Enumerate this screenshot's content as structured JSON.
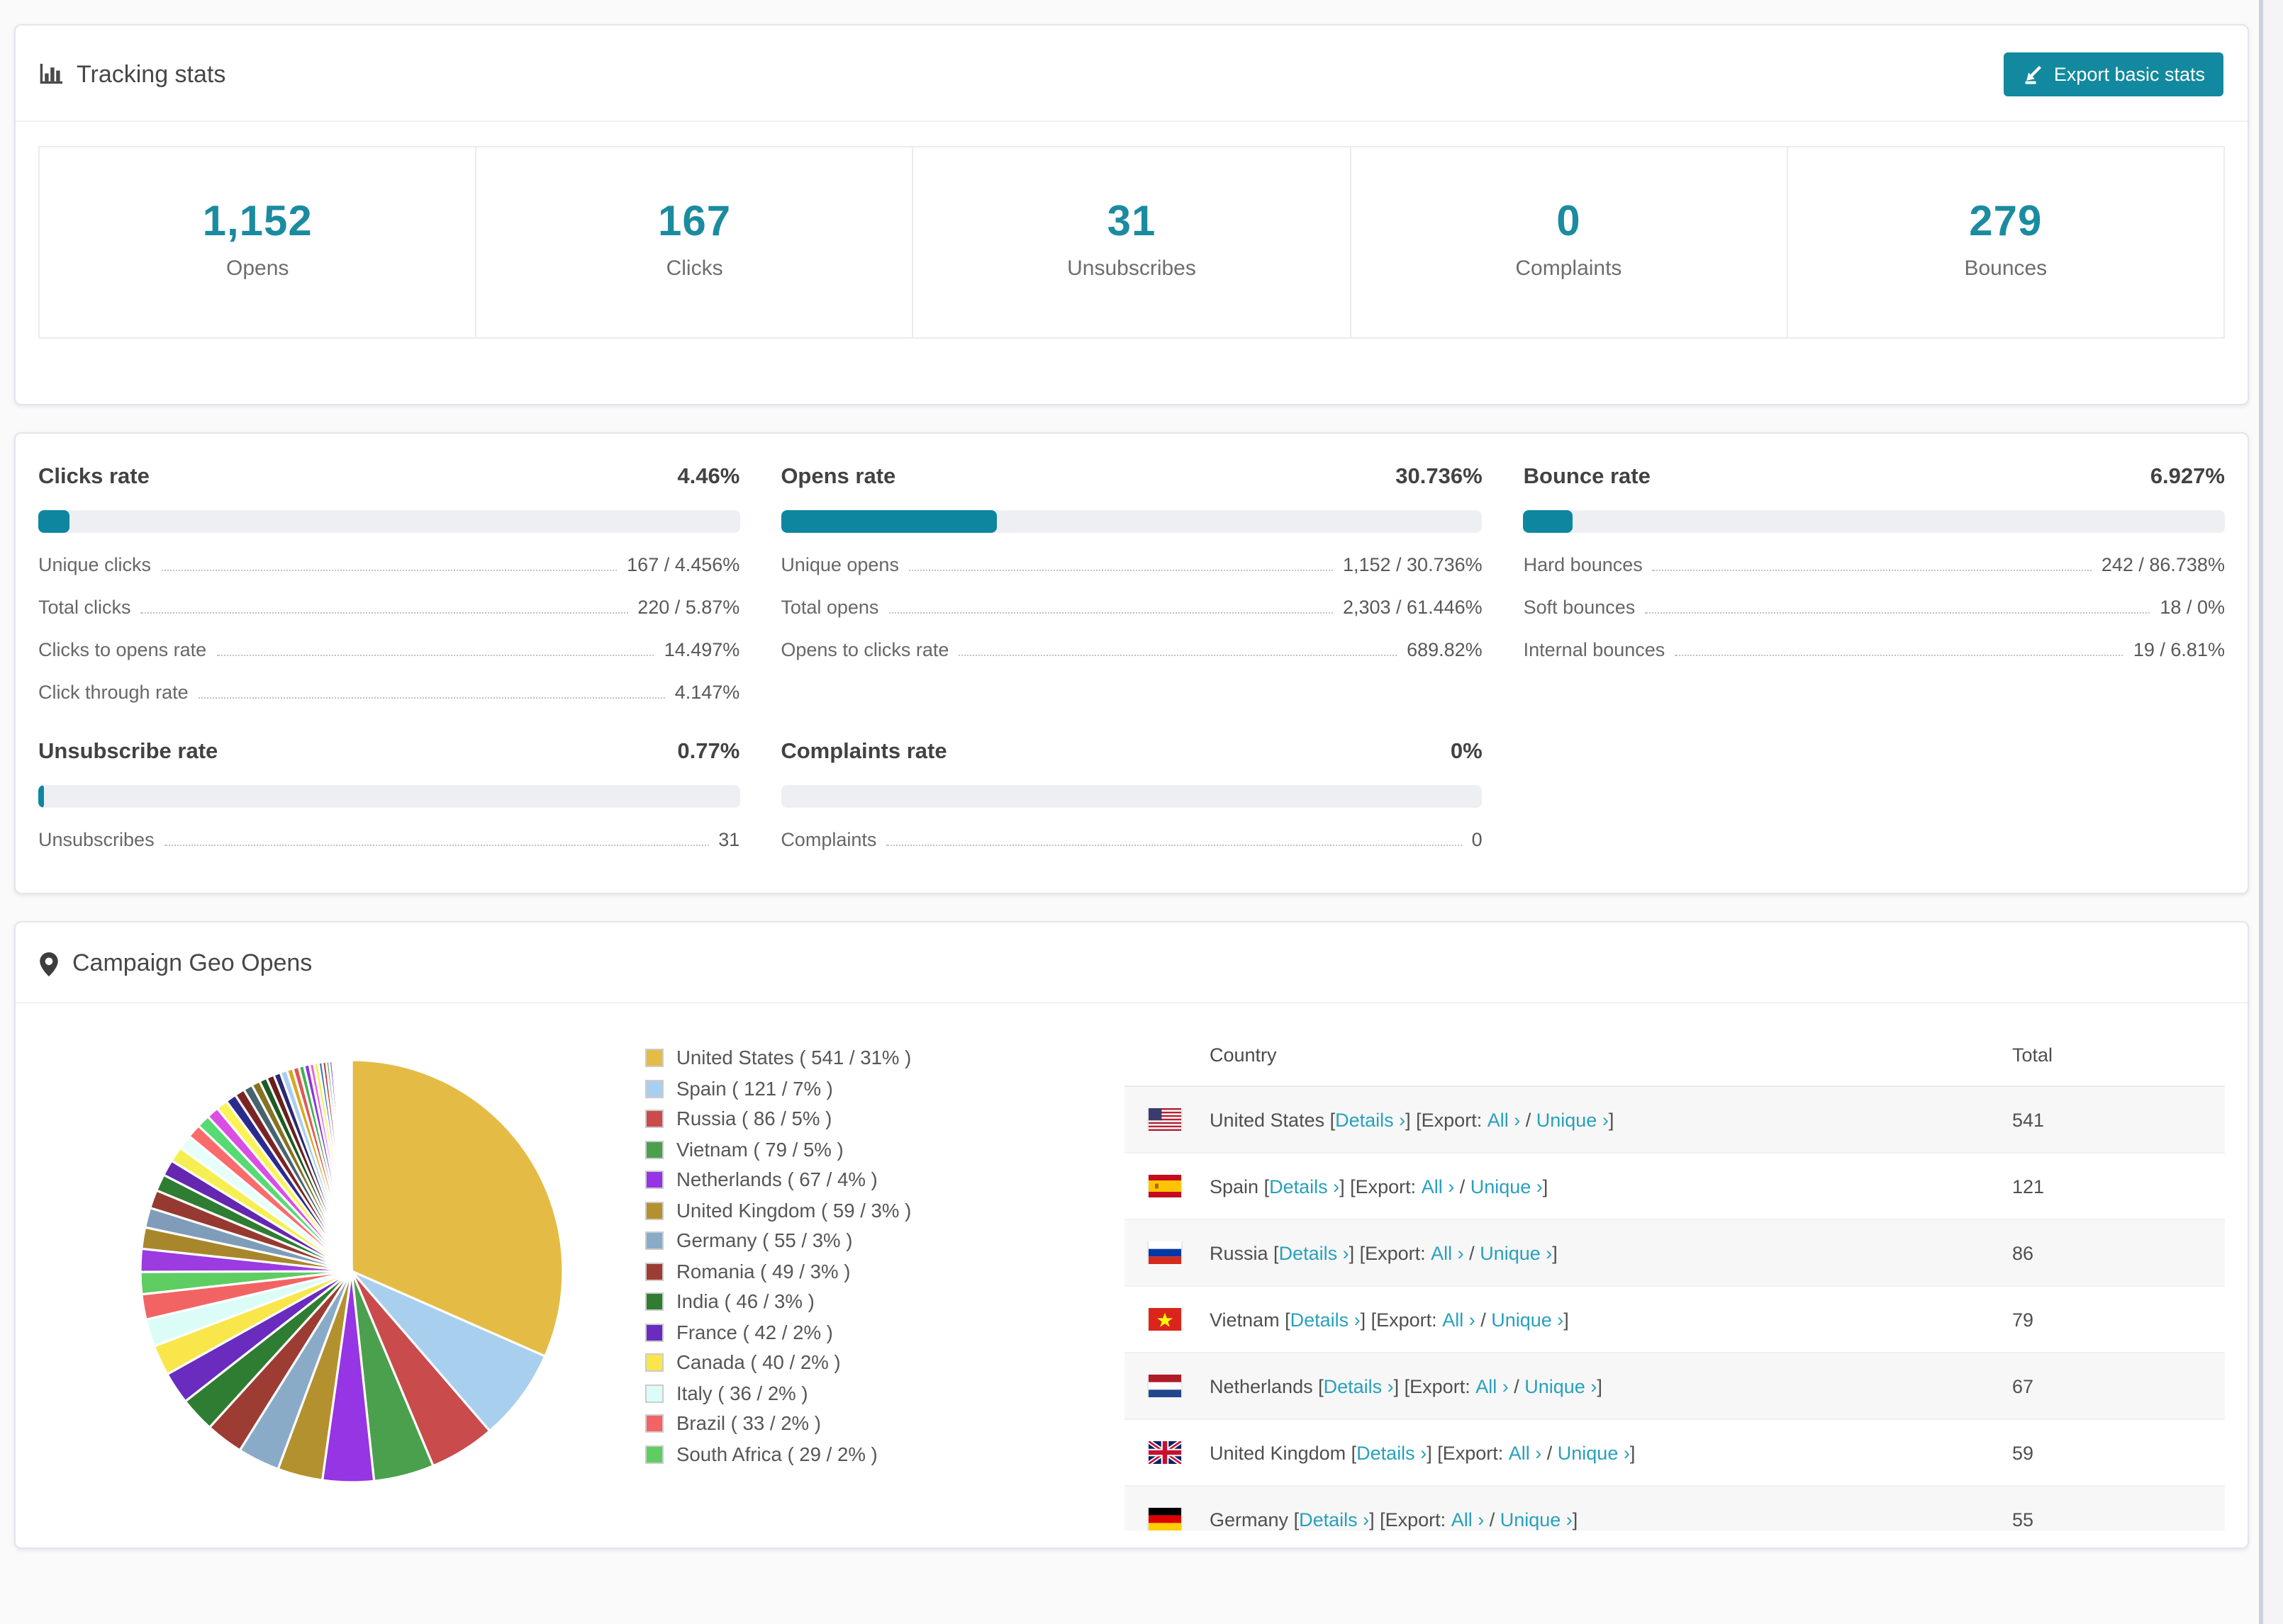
{
  "colors": {
    "accent": "#12899e",
    "stat_value": "#1b8ba0",
    "progress_fill": "#0e86a0",
    "progress_track": "#edeff2",
    "link": "#28a0bc"
  },
  "tracking": {
    "title": "Tracking stats",
    "export_button_label": "Export basic stats",
    "stats": [
      {
        "value": "1,152",
        "label": "Opens"
      },
      {
        "value": "167",
        "label": "Clicks"
      },
      {
        "value": "31",
        "label": "Unsubscribes"
      },
      {
        "value": "0",
        "label": "Complaints"
      },
      {
        "value": "279",
        "label": "Bounces"
      }
    ]
  },
  "rates": [
    {
      "title": "Clicks rate",
      "percent": "4.46%",
      "bar": 4.46,
      "rows": [
        [
          "Unique clicks",
          "167 / 4.456%"
        ],
        [
          "Total clicks",
          "220 / 5.87%"
        ],
        [
          "Clicks to opens rate",
          "14.497%"
        ],
        [
          "Click through rate",
          "4.147%"
        ]
      ]
    },
    {
      "title": "Opens rate",
      "percent": "30.736%",
      "bar": 30.736,
      "rows": [
        [
          "Unique opens",
          "1,152 / 30.736%"
        ],
        [
          "Total opens",
          "2,303 / 61.446%"
        ],
        [
          "Opens to clicks rate",
          "689.82%"
        ]
      ]
    },
    {
      "title": "Bounce rate",
      "percent": "6.927%",
      "bar": 6.927,
      "rows": [
        [
          "Hard bounces",
          "242 / 86.738%"
        ],
        [
          "Soft bounces",
          "18 / 0%"
        ],
        [
          "Internal bounces",
          "19 / 6.81%"
        ]
      ]
    },
    {
      "title": "Unsubscribe rate",
      "percent": "0.77%",
      "bar": 0.77,
      "rows": [
        [
          "Unsubscribes",
          "31"
        ]
      ]
    },
    {
      "title": "Complaints rate",
      "percent": "0%",
      "bar": 0,
      "rows": [
        [
          "Complaints",
          "0"
        ]
      ]
    }
  ],
  "geo": {
    "title": "Campaign Geo Opens",
    "chart_data": {
      "type": "pie",
      "title": "Campaign Geo Opens",
      "labels": [
        "United States",
        "Spain",
        "Russia",
        "Vietnam",
        "Netherlands",
        "United Kingdom",
        "Germany",
        "Romania",
        "India",
        "France",
        "Canada",
        "Italy",
        "Brazil",
        "South Africa"
      ],
      "values": [
        541,
        121,
        86,
        79,
        67,
        59,
        55,
        49,
        46,
        42,
        40,
        36,
        33,
        29
      ],
      "percents": [
        31,
        7,
        5,
        5,
        4,
        3,
        3,
        3,
        3,
        2,
        2,
        2,
        2,
        2
      ],
      "colors": [
        "#e4bc45",
        "#a9cfee",
        "#c94b4b",
        "#4ba04e",
        "#9535e4",
        "#b3912e",
        "#8aabc8",
        "#9c3c33",
        "#2e7d32",
        "#6a2bbf",
        "#f9e64a",
        "#dcfdf7",
        "#f26464",
        "#5ecd62"
      ],
      "legend_position": "right",
      "start_angle_deg": -90,
      "direction": "clockwise",
      "unlabeled_tail_estimated": {
        "values": [
          30,
          28,
          26,
          24,
          22,
          21,
          20,
          19,
          18,
          17,
          16,
          15,
          14,
          13,
          12,
          11,
          10,
          10,
          9,
          9,
          8,
          8,
          7,
          7,
          6,
          6,
          5,
          5,
          4,
          4,
          3,
          3,
          3,
          2,
          2,
          2,
          2,
          1,
          1,
          1,
          1,
          1,
          1,
          1,
          1
        ],
        "palette": [
          "#9b3be0",
          "#a8872c",
          "#7f9db9",
          "#963a31",
          "#2f7d33",
          "#6527b0",
          "#f6ef53",
          "#e7fffb",
          "#fa6b6b",
          "#57da74",
          "#d94fe3",
          "#fbf356",
          "#2b2b8f",
          "#7c2424",
          "#47636f",
          "#857222",
          "#1e5a23",
          "#68201d",
          "#2a2a72",
          "#a9cfee",
          "#d8a725",
          "#e25555",
          "#43b050",
          "#8b35df",
          "#e868d8",
          "#f2f25c",
          "#2f6fbf",
          "#c23a3a",
          "#3a8f43",
          "#7a3bd0",
          "#ff8855",
          "#44c2c2",
          "#b5b52e",
          "#d05070",
          "#5577ee",
          "#77dd55",
          "#ee4499",
          "#ffdd44",
          "#3344aa",
          "#aa3322",
          "#55aa77",
          "#9944bb",
          "#ffaa33",
          "#4488cc",
          "#cc6655"
        ]
      }
    },
    "legend_format": {
      "open": " ( ",
      "mid": " / ",
      "close": "% )"
    },
    "table": {
      "headers": [
        "Country",
        "Total"
      ],
      "link_labels": {
        "details": "Details ›",
        "all": "All ›",
        "unique": "Unique ›"
      },
      "separators": {
        "open": " [",
        "export": "] [Export: ",
        "slash": " / ",
        "close": "]"
      },
      "rows": [
        {
          "country": "United States",
          "flag": "us",
          "total": "541"
        },
        {
          "country": "Spain",
          "flag": "es",
          "total": "121"
        },
        {
          "country": "Russia",
          "flag": "ru",
          "total": "86"
        },
        {
          "country": "Vietnam",
          "flag": "vn",
          "total": "79"
        },
        {
          "country": "Netherlands",
          "flag": "nl",
          "total": "67"
        },
        {
          "country": "United Kingdom",
          "flag": "gb",
          "total": "59"
        },
        {
          "country": "Germany",
          "flag": "de",
          "total": "55"
        }
      ]
    }
  }
}
